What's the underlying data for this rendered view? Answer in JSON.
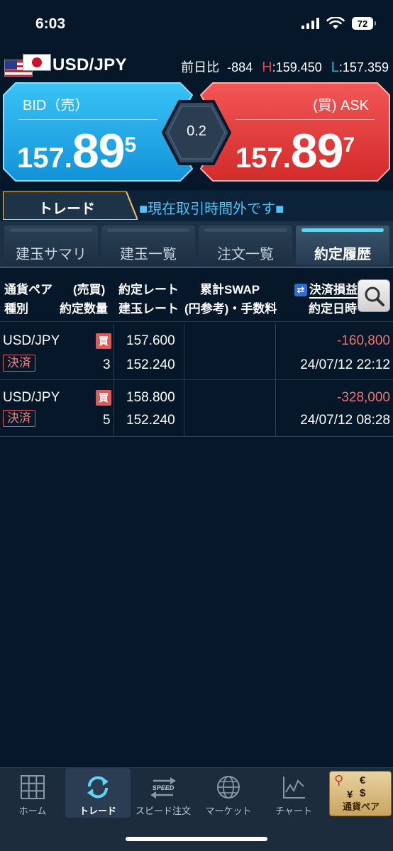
{
  "status": {
    "time": "6:03",
    "battery": "72"
  },
  "pair": {
    "name": "USD/JPY",
    "change_label": "前日比",
    "change_value": "-884",
    "high_label": "H",
    "high_value": "159.450",
    "low_label": "L",
    "low_value": "157.359"
  },
  "bid": {
    "label": "BID（売）",
    "price_small": "157.",
    "price_big": "89",
    "price_tiny": "5",
    "color": "#1ea3e6"
  },
  "ask": {
    "label": "(買) ASK",
    "price_small": "157.",
    "price_big": "89",
    "price_tiny": "7",
    "color": "#e33a3a"
  },
  "spread": "0.2",
  "trade_tab": "トレード",
  "market_status": "■現在取引時間外です■",
  "subtabs": [
    {
      "label": "建玉サマリ",
      "active": false
    },
    {
      "label": "建玉一覧",
      "active": false
    },
    {
      "label": "注文一覧",
      "active": false
    },
    {
      "label": "約定履歴",
      "active": true
    }
  ],
  "columns": {
    "pair": "通貨ペア",
    "side": "(売買)",
    "rate": "約定レート",
    "swap": "累計SWAP",
    "pl": "決済損益",
    "type": "種別",
    "qty": "約定数量",
    "open_rate": "建玉レート",
    "fee": "(円参考)・手数料",
    "datetime": "約定日時"
  },
  "rows": [
    {
      "pair": "USD/JPY",
      "side": "買",
      "type": "決済",
      "qty": "3",
      "rate": "157.600",
      "open_rate": "152.240",
      "pl": "-160,800",
      "datetime": "24/07/12 22:12"
    },
    {
      "pair": "USD/JPY",
      "side": "買",
      "type": "決済",
      "qty": "5",
      "rate": "158.800",
      "open_rate": "152.240",
      "pl": "-328,000",
      "datetime": "24/07/12 08:28"
    }
  ],
  "nav": {
    "home": "ホーム",
    "trade": "トレード",
    "speed": "スピード注文",
    "speed_icon_text": "SPEED",
    "market": "マーケット",
    "chart": "チャート",
    "currency_pair": "通貨ペア"
  }
}
